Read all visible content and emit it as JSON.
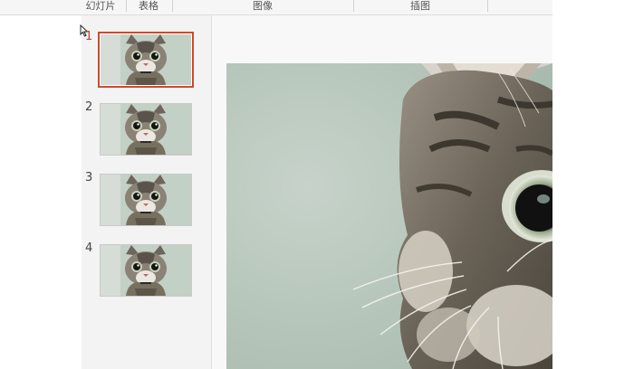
{
  "ribbon": {
    "groups": [
      {
        "label": "幻灯片"
      },
      {
        "label": "表格"
      },
      {
        "label": "图像"
      },
      {
        "label": "插图"
      }
    ]
  },
  "slides": [
    {
      "number": "1",
      "selected": true
    },
    {
      "number": "2",
      "selected": false
    },
    {
      "number": "3",
      "selected": false
    },
    {
      "number": "4",
      "selected": false
    }
  ],
  "colors": {
    "selection_border": "#d0482e",
    "slide_background": "#b8c7bd"
  },
  "main_slide": {
    "content": "cat-photo"
  }
}
